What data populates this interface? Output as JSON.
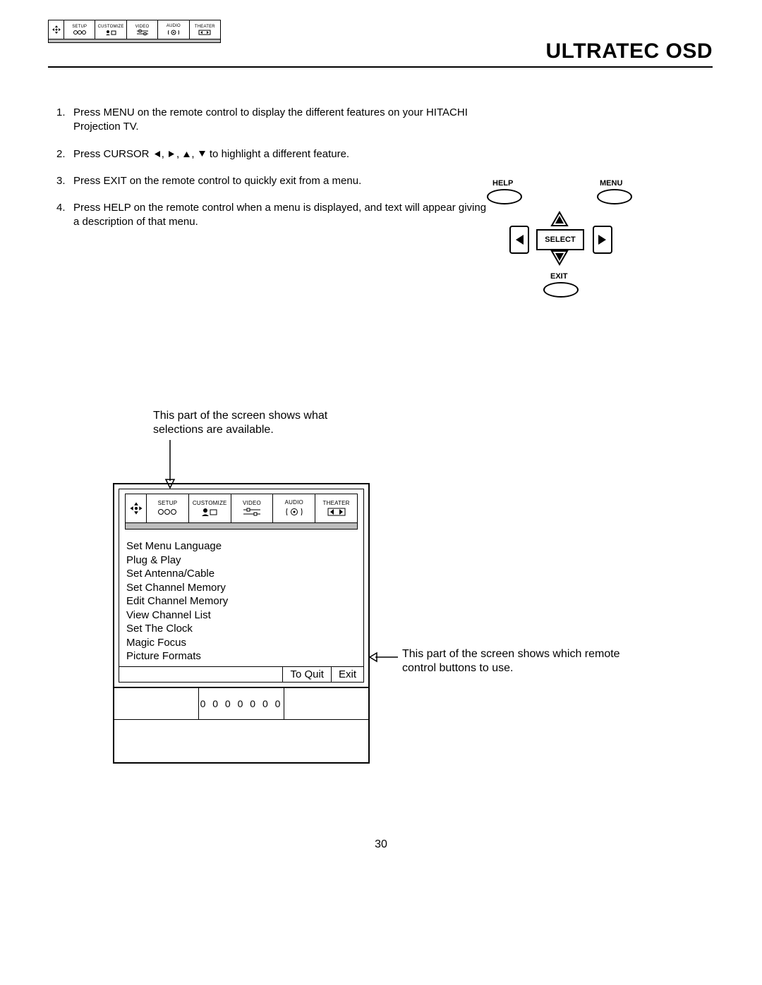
{
  "header": {
    "title": "ULTRATEC OSD",
    "osd_tabs": [
      "SETUP",
      "CUSTOMIZE",
      "VIDEO",
      "AUDIO",
      "THEATER"
    ]
  },
  "steps": [
    {
      "num": "1.",
      "text": "Press MENU on the remote control to display the different features on your HITACHI Projection TV."
    },
    {
      "num": "2.",
      "text_before": "Press CURSOR ",
      "text_after": " to highlight a different feature."
    },
    {
      "num": "3.",
      "text": "Press EXIT on the remote control to quickly exit from a menu."
    },
    {
      "num": "4.",
      "text": "Press HELP on the remote control when a menu is displayed, and text will appear giving a description of that menu."
    }
  ],
  "remote": {
    "help": "HELP",
    "menu": "MENU",
    "select": "SELECT",
    "exit": "EXIT"
  },
  "annotations": {
    "top": "This part of the screen shows what selections are available.",
    "right": "This part of the screen shows which remote control buttons to use."
  },
  "tv_menu": {
    "items": [
      "Set Menu Language",
      "Plug & Play",
      "Set Antenna/Cable",
      "Set Channel Memory",
      "Edit Channel Memory",
      "View Channel List",
      "Set The Clock",
      "Magic Focus",
      "Picture Formats"
    ],
    "quit_label": "To Quit",
    "exit_label": "Exit",
    "speaker_pattern": "0 0 0 0 0 0 0"
  },
  "page_number": "30"
}
